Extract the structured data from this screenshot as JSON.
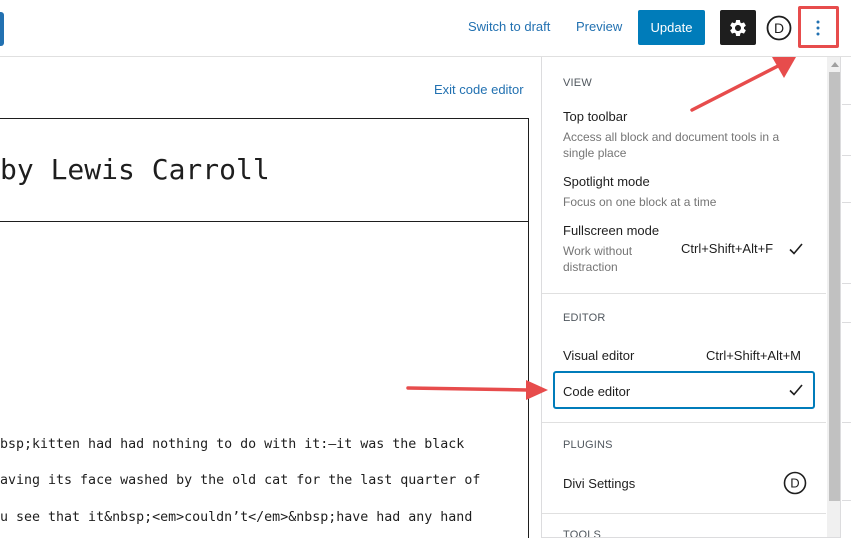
{
  "header": {
    "switch_to_draft": "Switch to draft",
    "preview": "Preview",
    "update": "Update",
    "settings_icon": "gear-icon",
    "divi_icon": "divi-logo-icon",
    "divi_letter": "D",
    "more_icon": "vertical-ellipsis-icon"
  },
  "editor": {
    "exit_code_editor": "Exit code editor",
    "title": "by Lewis Carroll",
    "code_lines": [
      "bsp;kitten had had nothing to do with it:—it was the black",
      "aving its face washed by the old cat for the last quarter of",
      "u see that it&nbsp;<em>couldn’t</em>&nbsp;have had any hand"
    ]
  },
  "menu": {
    "view": {
      "heading": "View",
      "top_toolbar": {
        "label": "Top toolbar",
        "desc": "Access all block and document tools in a single place"
      },
      "spotlight": {
        "label": "Spotlight mode",
        "desc": "Focus on one block at a time"
      },
      "fullscreen": {
        "label": "Fullscreen mode",
        "desc": "Work without distraction",
        "shortcut": "Ctrl+Shift+Alt+F",
        "checked": true
      }
    },
    "editor": {
      "heading": "Editor",
      "visual": {
        "label": "Visual editor",
        "shortcut": "Ctrl+Shift+Alt+M"
      },
      "code": {
        "label": "Code editor",
        "checked": true
      }
    },
    "plugins": {
      "heading": "Plugins",
      "divi": {
        "label": "Divi Settings",
        "icon": "divi-logo-icon",
        "letter": "D"
      }
    },
    "tools": {
      "heading": "Tools"
    }
  },
  "colors": {
    "accent": "#007cba",
    "link": "#2271b1",
    "annotation": "#e74c4c",
    "dark": "#1e1e1e"
  }
}
